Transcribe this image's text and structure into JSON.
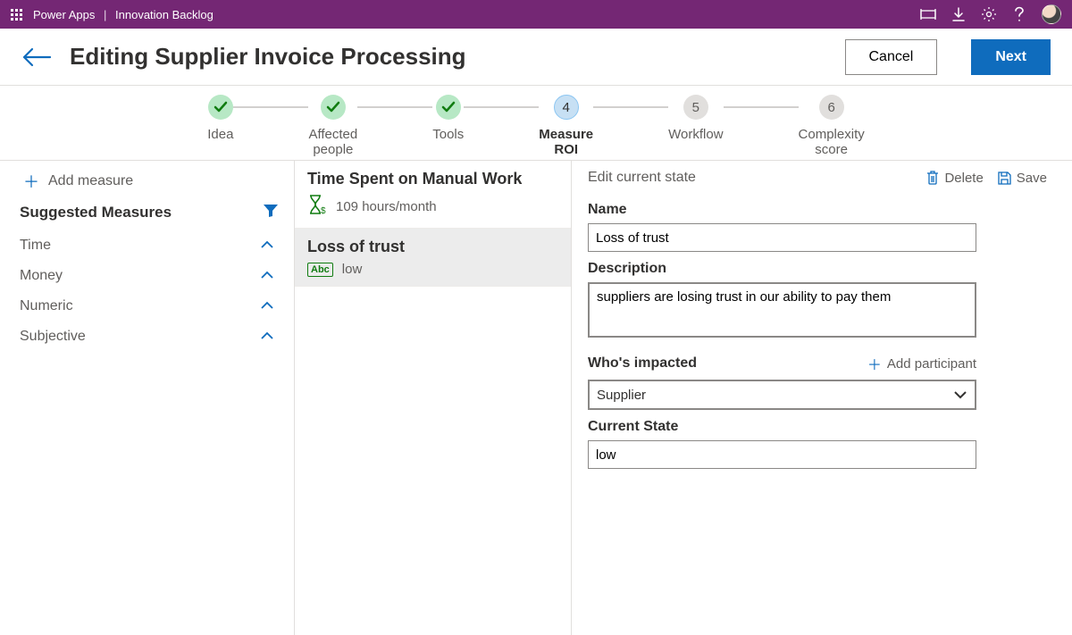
{
  "topbar": {
    "app": "Power Apps",
    "page": "Innovation Backlog"
  },
  "header": {
    "title": "Editing Supplier Invoice Processing",
    "cancel": "Cancel",
    "next": "Next"
  },
  "stepper": {
    "steps": [
      {
        "label": "Idea",
        "state": "done"
      },
      {
        "label": "Affected\npeople",
        "state": "done"
      },
      {
        "label": "Tools",
        "state": "done"
      },
      {
        "label": "Measure\nROI",
        "state": "current",
        "num": "4"
      },
      {
        "label": "Workflow",
        "state": "future",
        "num": "5"
      },
      {
        "label": "Complexity\nscore",
        "state": "future",
        "num": "6"
      }
    ]
  },
  "sidebar": {
    "add_measure": "Add measure",
    "suggested_heading": "Suggested Measures",
    "categories": [
      "Time",
      "Money",
      "Numeric",
      "Subjective"
    ]
  },
  "measures": [
    {
      "title": "Time Spent on Manual Work",
      "sub": "109 hours/month",
      "icon": "hourglass",
      "selected": false
    },
    {
      "title": "Loss of trust",
      "sub": "low",
      "icon": "abc",
      "selected": true
    }
  ],
  "detail": {
    "heading": "Edit current state",
    "delete": "Delete",
    "save": "Save",
    "name_label": "Name",
    "name_value": "Loss of trust",
    "description_label": "Description",
    "description_value": "suppliers are losing trust in our ability to pay them",
    "impacted_label": "Who's impacted",
    "add_participant": "Add participant",
    "impacted_value": "Supplier",
    "current_state_label": "Current State",
    "current_state_value": "low"
  }
}
